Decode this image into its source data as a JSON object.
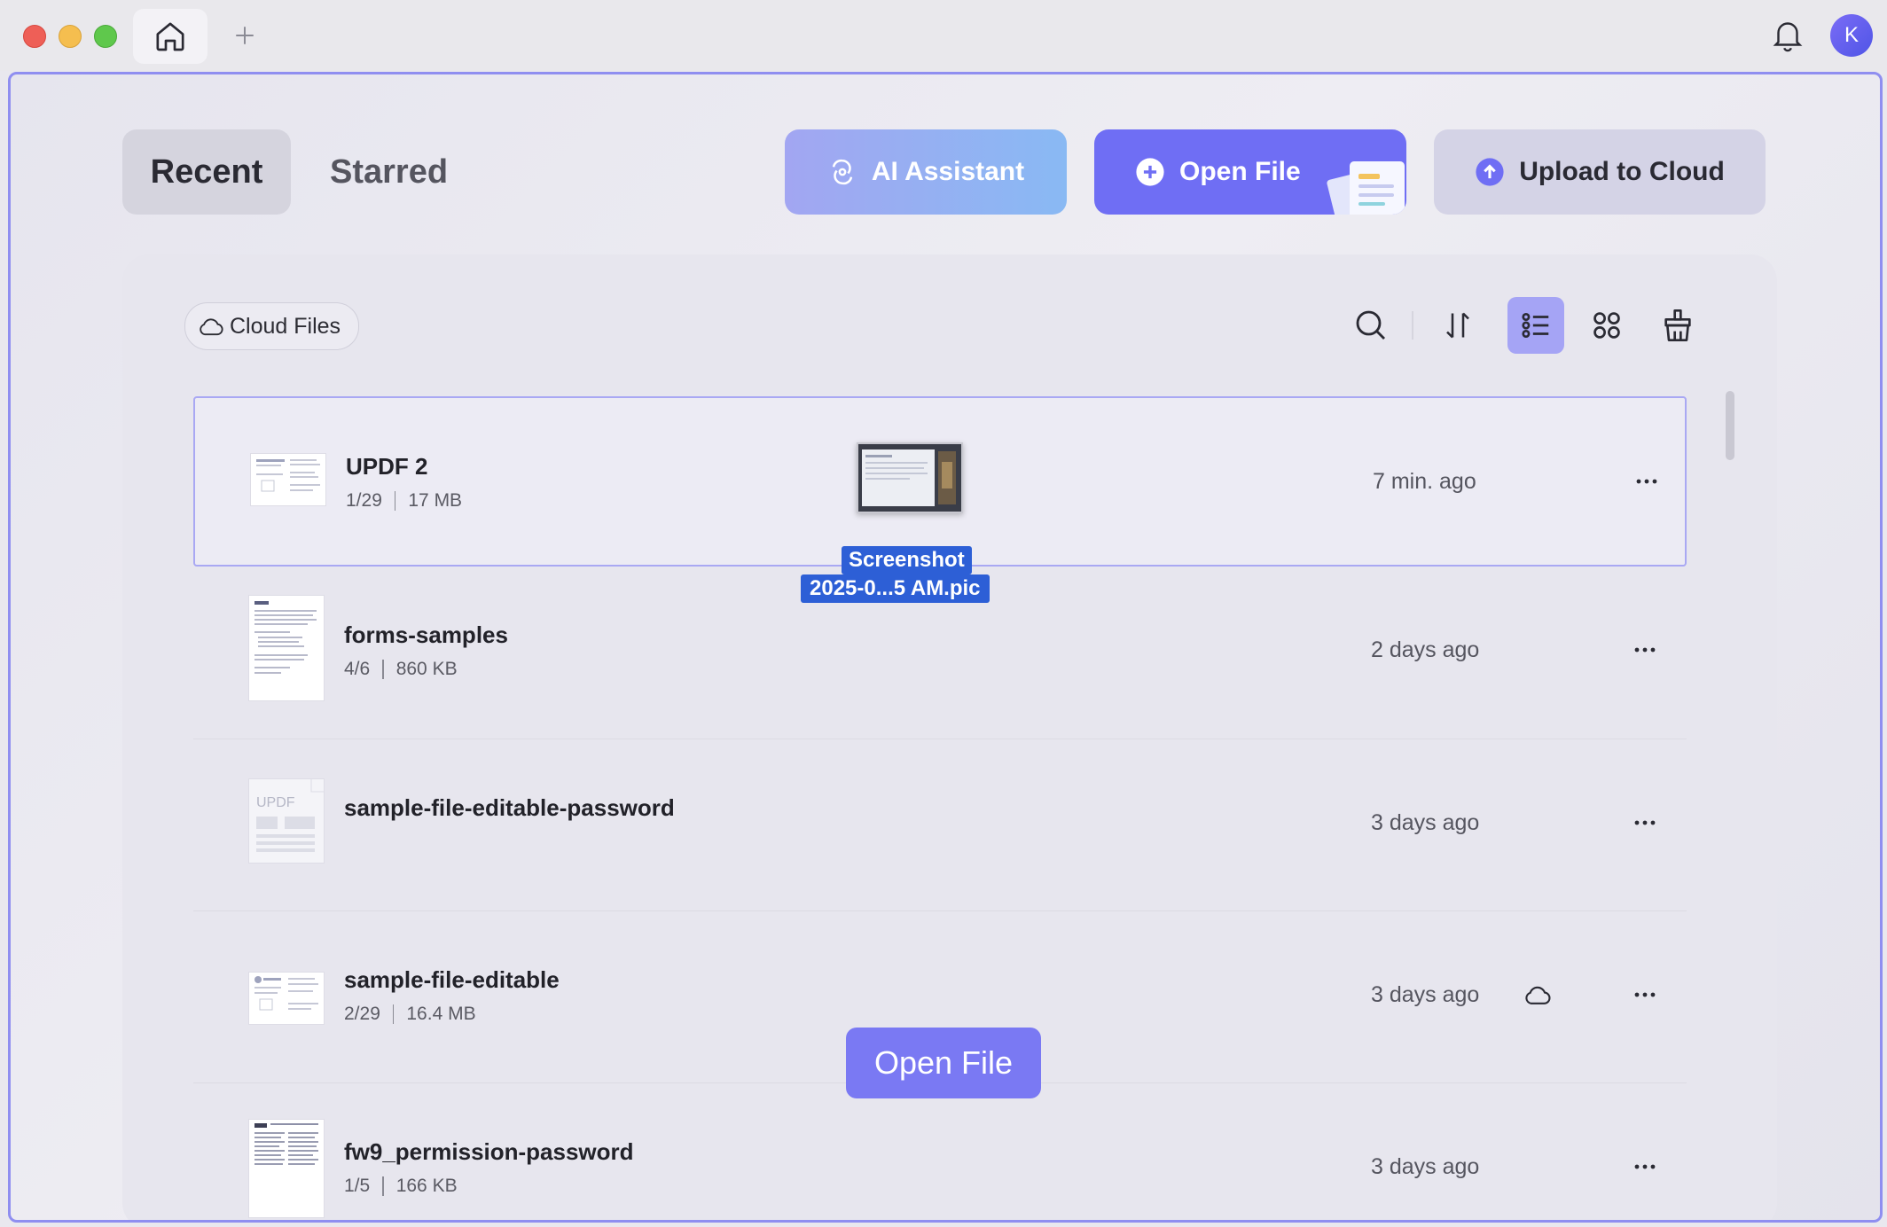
{
  "titlebar": {
    "avatar_initial": "K"
  },
  "tabs": {
    "recent": "Recent",
    "starred": "Starred"
  },
  "actions": {
    "ai_assistant": "AI Assistant",
    "open_file": "Open File",
    "upload_to_cloud": "Upload to Cloud"
  },
  "toolbar": {
    "cloud_files": "Cloud Files",
    "icons": [
      "search-icon",
      "sort-icon",
      "list-view-icon",
      "grid-view-icon",
      "clean-icon"
    ],
    "active_view": "list"
  },
  "files": [
    {
      "name": "UPDF 2",
      "pages": "1/29",
      "size": "17 MB",
      "time": "7 min. ago",
      "selected": true
    },
    {
      "name": "forms-samples",
      "pages": "4/6",
      "size": "860 KB",
      "time": "2 days ago"
    },
    {
      "name": "sample-file-editable-password",
      "pages": "",
      "size": "",
      "time": "3 days ago",
      "thumbnail_text": "UPDF"
    },
    {
      "name": "sample-file-editable",
      "pages": "2/29",
      "size": "16.4 MB",
      "time": "3 days ago",
      "cloud": true
    },
    {
      "name": "fw9_permission-password",
      "pages": "1/5",
      "size": "166 KB",
      "time": "3 days ago"
    }
  ],
  "drag": {
    "label_line1": "Screenshot",
    "label_line2": "2025-0...5 AM.pic",
    "drop_label": "Open File"
  },
  "colors": {
    "accent": "#6f6ef4",
    "window_border": "#8f8ef0",
    "drag_label": "#2d5fd6"
  }
}
